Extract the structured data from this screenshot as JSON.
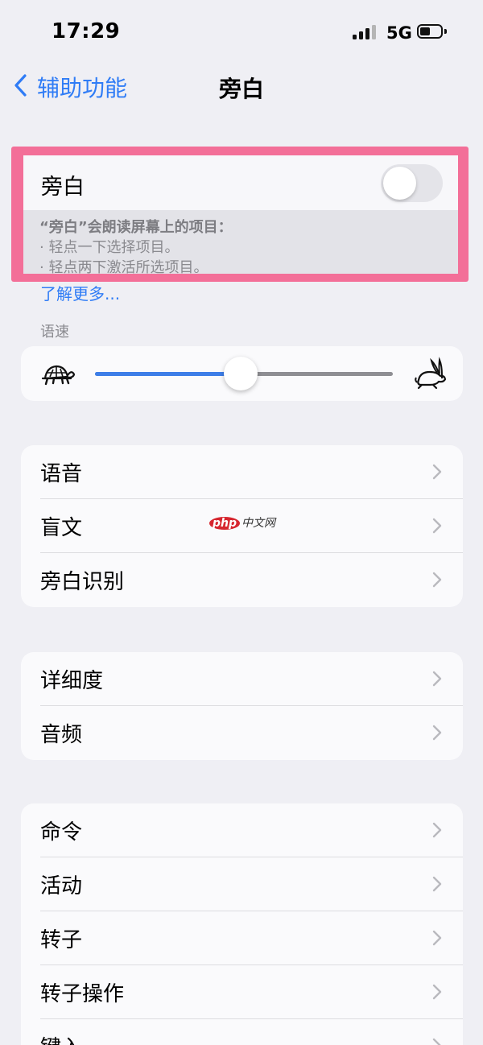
{
  "status_bar": {
    "time": "17:29",
    "network": "5G"
  },
  "nav": {
    "back_label": "辅助功能",
    "title": "旁白"
  },
  "voiceover": {
    "label": "旁白",
    "enabled": false,
    "description_title": "“旁白”会朗读屏幕上的项目：",
    "description_items": [
      "轻点一下选择项目。",
      "轻点两下激活所选项目。"
    ],
    "learn_more": "了解更多..."
  },
  "speaking_rate": {
    "section_label": "语速",
    "value_percent": 49,
    "slow_icon": "turtle-icon",
    "fast_icon": "rabbit-icon"
  },
  "group1": [
    {
      "label": "语音"
    },
    {
      "label": "盲文"
    },
    {
      "label": "旁白识别"
    }
  ],
  "group2": [
    {
      "label": "详细度"
    },
    {
      "label": "音频"
    }
  ],
  "group3": [
    {
      "label": "命令"
    },
    {
      "label": "活动"
    },
    {
      "label": "转子"
    },
    {
      "label": "转子操作"
    },
    {
      "label": "键入"
    }
  ],
  "watermark": {
    "brand": "php",
    "text": "中文网"
  },
  "colors": {
    "accent": "#2f7cf6",
    "highlight": "#f36f98",
    "slider": "#3d7ee8",
    "background": "#efeff4"
  }
}
